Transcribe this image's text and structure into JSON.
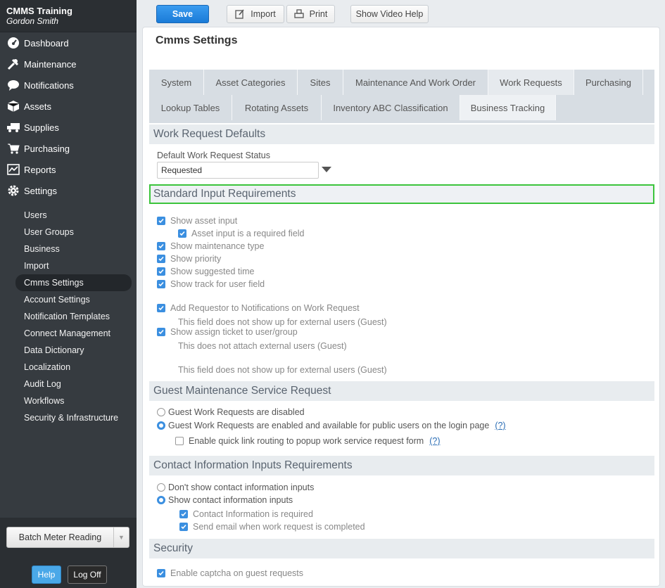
{
  "app": {
    "org": "CMMS Training",
    "user": "Gordon Smith"
  },
  "nav": [
    {
      "label": "Dashboard",
      "icon": "dashboard-icon"
    },
    {
      "label": "Maintenance",
      "icon": "tools-icon"
    },
    {
      "label": "Notifications",
      "icon": "chat-icon"
    },
    {
      "label": "Assets",
      "icon": "box-icon"
    },
    {
      "label": "Supplies",
      "icon": "truck-icon"
    },
    {
      "label": "Purchasing",
      "icon": "cart-icon"
    },
    {
      "label": "Reports",
      "icon": "chart-icon"
    },
    {
      "label": "Settings",
      "icon": "gear-icon"
    }
  ],
  "subnav": [
    "Users",
    "User Groups",
    "Business",
    "Import",
    "Cmms Settings",
    "Account Settings",
    "Notification Templates",
    "Connect Management",
    "Data Dictionary",
    "Localization",
    "Audit Log",
    "Workflows",
    "Security & Infrastructure"
  ],
  "subnav_active": "Cmms Settings",
  "sidebar_bottom": {
    "batch": "Batch Meter Reading",
    "help": "Help",
    "logoff": "Log Off"
  },
  "toolbar": {
    "save": "Save",
    "import": "Import",
    "print": "Print",
    "video": "Show Video Help"
  },
  "page_title": "Cmms Settings",
  "tabs_row1": [
    "System",
    "Asset Categories",
    "Sites",
    "Maintenance And Work Order",
    "Work Requests",
    "Purchasing"
  ],
  "tabs_row2": [
    "Lookup Tables",
    "Rotating Assets",
    "Inventory ABC Classification",
    "Business Tracking"
  ],
  "active_tab": "Work Requests",
  "defaults": {
    "header": "Work Request Defaults",
    "status_label": "Default Work Request Status",
    "status_value": "Requested"
  },
  "standard": {
    "header": "Standard Input Requirements",
    "items": [
      "Show asset input",
      "Asset input is a required field",
      "Show maintenance type",
      "Show priority",
      "Show suggested time",
      "Show track for user field",
      "This field does not show up for external users (Guest)",
      "Add Requestor to Notifications on Work Request",
      "This does not attach external users (Guest)",
      "Show assign ticket to user/group",
      "This field does not show up for external users (Guest)"
    ]
  },
  "guest": {
    "header": "Guest Maintenance Service Request",
    "disabled": "Guest Work Requests are disabled",
    "enabled": "Guest Work Requests are enabled and available for public users on the login page",
    "quicklink": "Enable quick link routing to popup work service request form",
    "help": "(?)"
  },
  "contact": {
    "header": "Contact Information Inputs Requirements",
    "dont_show": "Don't show contact information inputs",
    "show": "Show contact information inputs",
    "required": "Contact Information is required",
    "email": "Send email when work request is completed"
  },
  "security": {
    "header": "Security",
    "captcha": "Enable captcha on guest requests"
  }
}
